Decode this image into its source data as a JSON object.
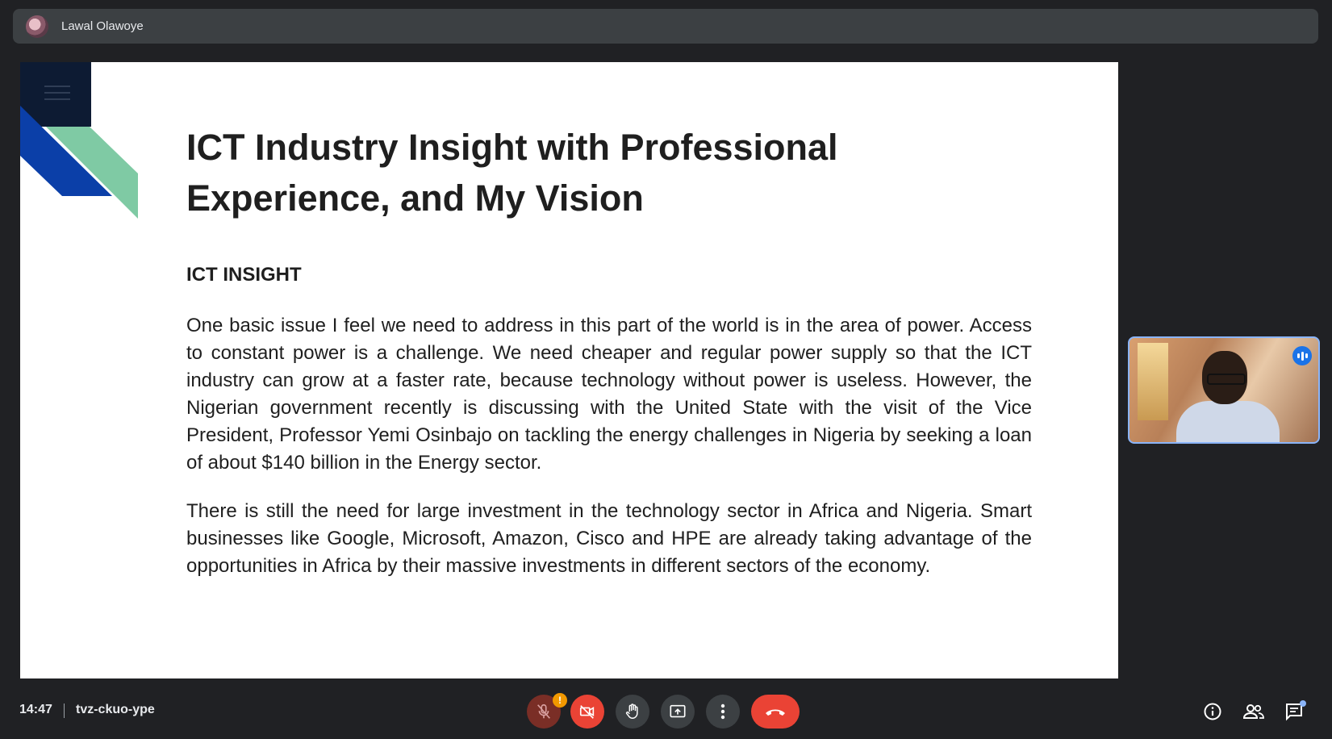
{
  "presenter": {
    "name": "Lawal Olawoye"
  },
  "slide": {
    "title": "ICT Industry Insight with Professional Experience, and My Vision",
    "section_heading": "ICT INSIGHT",
    "paragraph_1": "One basic issue I feel we need to address in this part of the world is in the area of power. Access to constant power is a challenge. We need cheaper and regular power supply so that the ICT industry can grow at a faster rate, because technology without power is useless. However, the Nigerian government recently is discussing with the United State with the visit of the Vice President, Professor Yemi Osinbajo on tackling the energy challenges in Nigeria by seeking a loan of about $140 billion in the Energy sector.",
    "paragraph_2": "There is still the need for large investment in the technology sector in Africa and Nigeria. Smart businesses like Google, Microsoft, Amazon, Cisco and HPE are already taking advantage of the opportunities in Africa by their massive investments in different sectors of the economy.",
    "deco_colors": {
      "navy": "#0d1b33",
      "blue": "#0b3fa8",
      "green": "#7fcaa4"
    }
  },
  "bottom_bar": {
    "time": "14:47",
    "meeting_code": "tvz-ckuo-ype",
    "mic_warning_badge": "!"
  },
  "icons": {
    "mic": "mic-off-icon",
    "camera": "camera-off-icon",
    "hand": "raise-hand-icon",
    "present": "present-screen-icon",
    "more": "more-options-icon",
    "end_call": "end-call-icon",
    "info": "info-icon",
    "people": "people-icon",
    "chat": "chat-icon"
  },
  "colors": {
    "accent": "#8ab4f8",
    "danger": "#ea4335",
    "warning": "#f29900",
    "bar_bg": "#3c4043"
  }
}
